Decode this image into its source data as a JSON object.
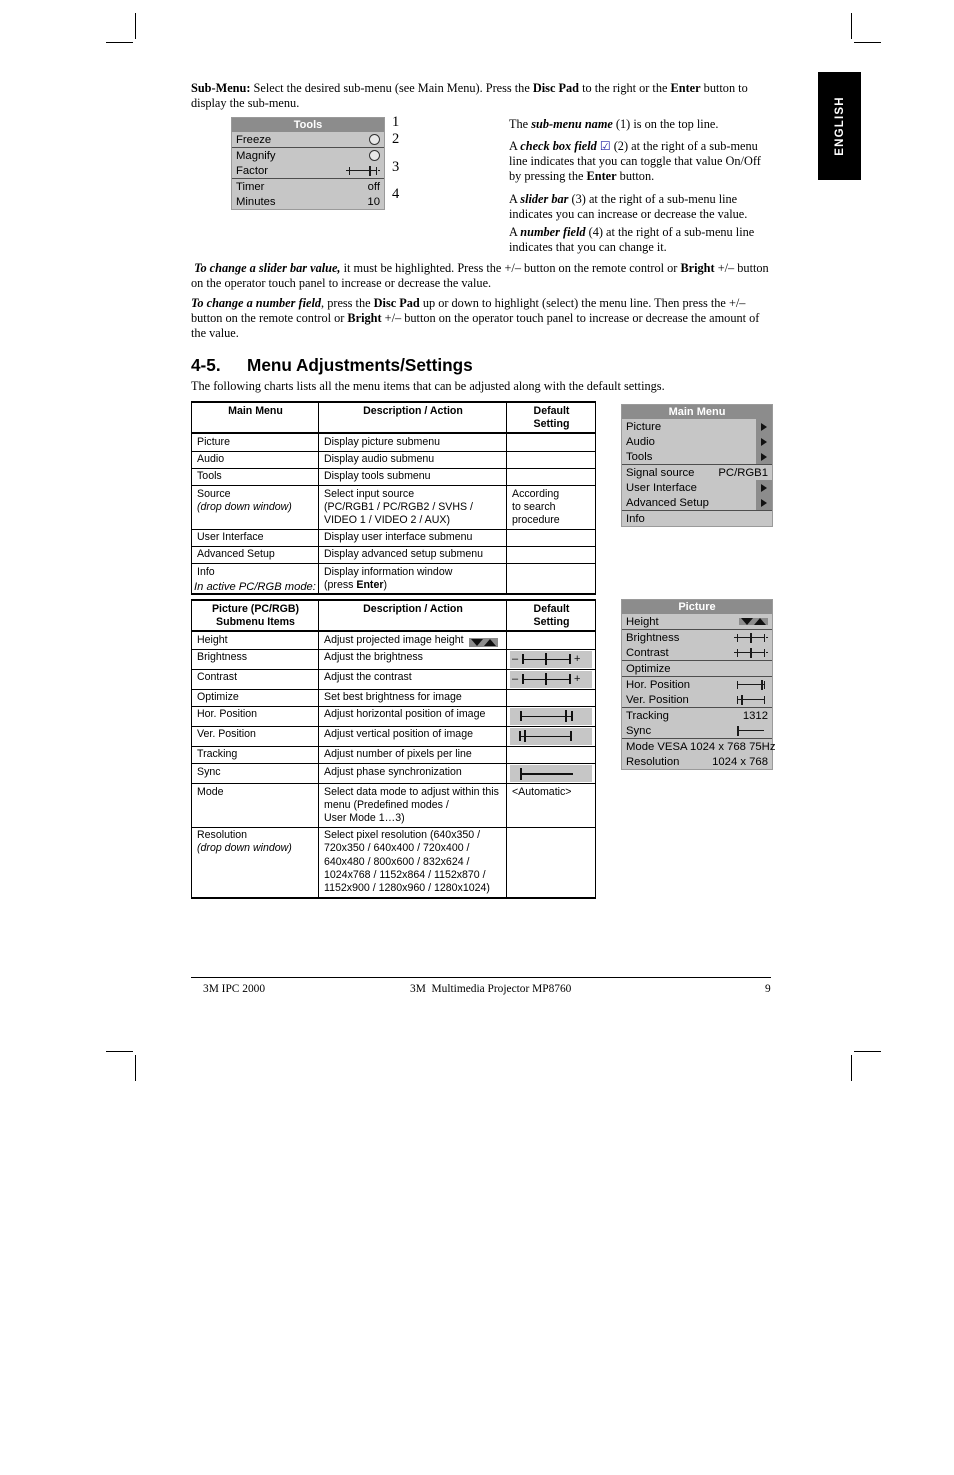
{
  "language_tab": "ENGLISH",
  "intro": {
    "lead_label": "Sub-Menu:",
    "lead_rest_a": " Select the desired sub-menu (see Main Menu). Press the ",
    "disc_pad": "Disc Pad",
    "lead_rest_b": " to the right or the ",
    "enter": "Enter",
    "lead_rest_c": " button to",
    "line2": "display the sub-menu."
  },
  "tools_menu": {
    "title": "Tools",
    "rows": [
      {
        "label": "Freeze",
        "value_type": "checkbox",
        "value": ""
      },
      {
        "label": "Magnify",
        "value_type": "checkbox",
        "value": ""
      },
      {
        "label": "Factor",
        "value_type": "slider",
        "value": ""
      },
      {
        "label": "Timer",
        "value_type": "text",
        "value": "off"
      },
      {
        "label": "Minutes",
        "value_type": "number",
        "value": "10"
      }
    ],
    "callouts": [
      "1",
      "2",
      "3",
      "4"
    ]
  },
  "descriptions": [
    {
      "parts": [
        {
          "t": "The ",
          "s": "n"
        },
        {
          "t": "sub-menu name",
          "s": "bi"
        },
        {
          "t": " (1) is on the top line.",
          "s": "n"
        }
      ]
    },
    {
      "parts": [
        {
          "t": "A ",
          "s": "n"
        },
        {
          "t": "check box field",
          "s": "bi"
        },
        {
          "t": " ☑",
          "s": "chk"
        },
        {
          "t": " (2) at the right of a sub-menu line indicates that you can toggle that value On/Off by pressing the ",
          "s": "n"
        },
        {
          "t": "Enter",
          "s": "b"
        },
        {
          "t": " button.",
          "s": "n"
        }
      ]
    },
    {
      "parts": [
        {
          "t": "A ",
          "s": "n"
        },
        {
          "t": "slider bar",
          "s": "bi"
        },
        {
          "t": " (3) at the right of a sub-menu line indicates you can increase or decrease the value.",
          "s": "n"
        }
      ]
    },
    {
      "parts": [
        {
          "t": "A ",
          "s": "n"
        },
        {
          "t": "number field",
          "s": "bi"
        },
        {
          "t": " (4) at the right of a sub-menu line indicates that you can change it.",
          "s": "n"
        }
      ]
    }
  ],
  "paragraph_slider": {
    "bold_italic": "To change a slider bar value,",
    "text_a": " it must be highlighted.  Press the +/– button on the remote control or ",
    "bold_b": "Bright",
    "text_b": " +/– button on the operator touch panel to increase or decrease the value."
  },
  "paragraph_number": {
    "bold_italic": "To change a number field",
    "text_a": ", press the ",
    "bold_a": "Disc Pad",
    "text_b": " up or down to highlight (select) the menu line.  Then press the +/– button on the remote control or ",
    "bold_b": "Bright",
    "text_c": " +/– button on the operator touch panel to increase or decrease the amount of the value."
  },
  "section": {
    "number": "4-5.",
    "title": "Menu Adjustments/Settings",
    "intro": "The following charts lists all the menu items that can be adjusted along with the default settings."
  },
  "main_table": {
    "headers": [
      "Main Menu",
      "Description / Action",
      "Default Setting"
    ],
    "header_default_line1": "Default",
    "header_default_line2": "Setting",
    "rows": [
      {
        "menu": "Picture",
        "menu_sub": "",
        "desc": [
          "Display picture submenu"
        ],
        "default": []
      },
      {
        "menu": "Audio",
        "menu_sub": "",
        "desc": [
          "Display audio submenu"
        ],
        "default": []
      },
      {
        "menu": "Tools",
        "menu_sub": "",
        "desc": [
          "Display tools submenu"
        ],
        "default": []
      },
      {
        "menu": "Source",
        "menu_sub": "(drop down window)",
        "desc": [
          "Select input source",
          "(PC/RGB1 / PC/RGB2 / SVHS /",
          "VIDEO 1 / VIDEO 2 / AUX)"
        ],
        "default": [
          "According",
          "to search",
          "procedure"
        ]
      },
      {
        "menu": "User Interface",
        "menu_sub": "",
        "desc": [
          "Display user interface submenu"
        ],
        "default": []
      },
      {
        "menu": "Advanced Setup",
        "menu_sub": "",
        "desc": [
          "Display advanced setup submenu"
        ],
        "default": []
      },
      {
        "menu": "Info",
        "menu_sub": "",
        "desc": [
          "Display information window",
          "(press Enter)"
        ],
        "default": []
      }
    ]
  },
  "main_menu_osd": {
    "title": "Main Menu",
    "rows": [
      {
        "label": "Picture",
        "value": "",
        "kind": "arrow"
      },
      {
        "label": "Audio",
        "value": "",
        "kind": "arrow"
      },
      {
        "label": "Tools",
        "value": "",
        "kind": "arrow"
      },
      {
        "label": "Signal source",
        "value": "PC/RGB1",
        "kind": "text"
      },
      {
        "label": "User Interface",
        "value": "",
        "kind": "arrow"
      },
      {
        "label": "Advanced Setup",
        "value": "",
        "kind": "arrow"
      },
      {
        "label": "Info",
        "value": "",
        "kind": "none"
      }
    ]
  },
  "pcrgb_caption": "In active PC/RGB mode:",
  "picture_table": {
    "header_col1_line1": "Picture (PC/RGB)",
    "header_col1_line2": "Submenu Items",
    "header_col2": "Description / Action",
    "header_col3_line1": "Default",
    "header_col3_line2": "Setting",
    "rows": [
      {
        "item": "Height",
        "item_sub": "",
        "desc": [
          "Adjust projected image height"
        ],
        "desc_icon": "updown",
        "default": [],
        "default_graphic": "none"
      },
      {
        "item": "Brightness",
        "item_sub": "",
        "desc": [
          "Adjust the brightness"
        ],
        "desc_icon": "none",
        "default": [],
        "default_graphic": "slider-center-pm"
      },
      {
        "item": "Contrast",
        "item_sub": "",
        "desc": [
          "Adjust the contrast"
        ],
        "desc_icon": "none",
        "default": [],
        "default_graphic": "slider-center-pm"
      },
      {
        "item": "Optimize",
        "item_sub": "",
        "desc": [
          "Set best brightness for image"
        ],
        "desc_icon": "none",
        "default": [],
        "default_graphic": "none"
      },
      {
        "item": "Hor. Position",
        "item_sub": "",
        "desc": [
          "Adjust horizontal position of image"
        ],
        "desc_icon": "none",
        "default": [],
        "default_graphic": "slider-right"
      },
      {
        "item": "Ver. Position",
        "item_sub": "",
        "desc": [
          "Adjust vertical position of image"
        ],
        "desc_icon": "none",
        "default": [],
        "default_graphic": "slider-left"
      },
      {
        "item": "Tracking",
        "item_sub": "",
        "desc": [
          "Adjust number of pixels per line"
        ],
        "desc_icon": "none",
        "default": [],
        "default_graphic": "none"
      },
      {
        "item": "Sync",
        "item_sub": "",
        "desc": [
          "Adjust phase synchronization"
        ],
        "desc_icon": "none",
        "default": [],
        "default_graphic": "slider-far-left"
      },
      {
        "item": "Mode",
        "item_sub": "",
        "desc": [
          "Select data mode to adjust within this",
          "menu (Predefined modes /",
          "User Mode 1…3)"
        ],
        "desc_icon": "none",
        "default": [
          "<Automatic>"
        ],
        "default_graphic": "none"
      },
      {
        "item": "Resolution",
        "item_sub": "(drop down window)",
        "desc": [
          "Select pixel resolution (640x350 /",
          "720x350 / 640x400 / 720x400 /",
          "640x480 / 800x600 / 832x624 /",
          "1024x768 / 1152x864 / 1152x870 /",
          "1152x900 / 1280x960 / 1280x1024)"
        ],
        "desc_icon": "none",
        "default": [],
        "default_graphic": "none"
      }
    ]
  },
  "picture_osd": {
    "title": "Picture",
    "rows": [
      {
        "label": "Height",
        "value": "",
        "kind": "updown"
      },
      {
        "label": "Brightness",
        "value": "",
        "kind": "slider-center"
      },
      {
        "label": "Contrast",
        "value": "",
        "kind": "slider-center"
      },
      {
        "label": "Optimize",
        "value": "",
        "kind": "none"
      },
      {
        "label": "Hor. Position",
        "value": "",
        "kind": "slider-right"
      },
      {
        "label": "Ver. Position",
        "value": "",
        "kind": "slider-left"
      },
      {
        "label": "Tracking",
        "value": "1312",
        "kind": "text"
      },
      {
        "label": "Sync",
        "value": "",
        "kind": "slider-farleft"
      },
      {
        "label": "Mode VESA 1024 x 768 75Hz",
        "value": "",
        "kind": "none"
      },
      {
        "label": "Resolution",
        "value": "1024 x 768",
        "kind": "text"
      }
    ]
  },
  "footer": {
    "left": "3M IPC 2000",
    "center_a": "3M",
    "center_b": "Multimedia Projector MP8760",
    "page": "9"
  }
}
